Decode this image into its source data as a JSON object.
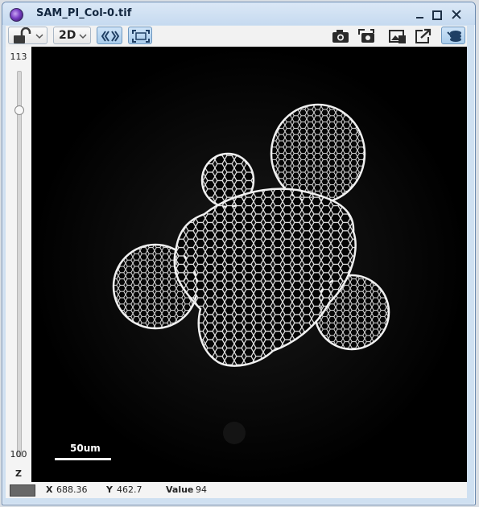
{
  "window": {
    "title": "SAM_PI_Col-0.tif"
  },
  "toolbar": {
    "lock_icon": "lock-open-icon",
    "view_mode": "2D",
    "view_mode_options": [
      "2D"
    ],
    "items": [
      {
        "name": "lock-dropdown",
        "icon": "lock-open-icon",
        "active": false
      },
      {
        "name": "view-mode-dropdown",
        "active": false
      },
      {
        "name": "channel-sync",
        "icon": "double-chevron-icon",
        "active": true
      },
      {
        "name": "fit-to-window",
        "icon": "fit-frame-icon",
        "active": true
      },
      {
        "name": "snapshot",
        "icon": "camera-icon",
        "active": false
      },
      {
        "name": "snapshot-to-clipboard",
        "icon": "camera-copy-icon",
        "active": false
      },
      {
        "name": "image-export",
        "icon": "image-icon",
        "active": false
      },
      {
        "name": "open-in-new-window",
        "icon": "external-link-icon",
        "active": false
      },
      {
        "name": "layers",
        "icon": "stack-icon",
        "active": true
      }
    ]
  },
  "slice_slider": {
    "max_label": "113",
    "min_label": "100",
    "axis_label": "Z",
    "value_fraction": 0.9
  },
  "viewer": {
    "scale_bar_label": "50um",
    "background_color": "#000000"
  },
  "status_bar": {
    "x_label": "X",
    "x_value": "688.36",
    "y_label": "Y",
    "y_value": "462.7",
    "value_label": "Value",
    "value": "94",
    "swatch_color": "#686868"
  },
  "colors": {
    "title_bar": "#c6daf0",
    "active_button": "#a9cceb",
    "cell_walls": "#ffffff"
  }
}
